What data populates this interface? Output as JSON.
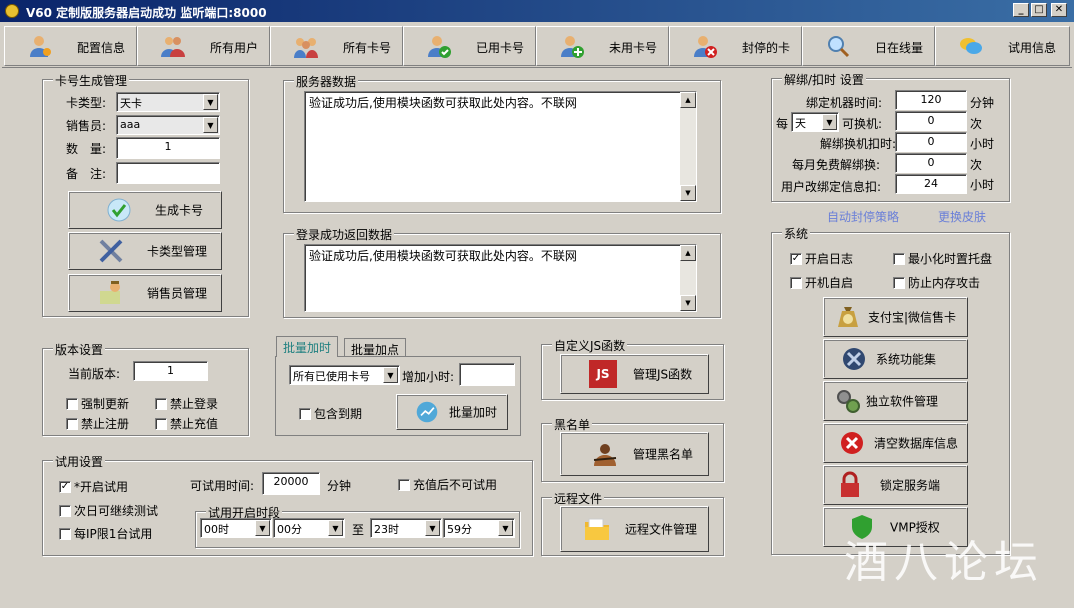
{
  "window": {
    "title": "V60 定制版服务器启动成功 监听端口:8000",
    "min": "_",
    "max": "□",
    "close": "✕"
  },
  "toolbar": [
    {
      "label": "配置信息",
      "icon": "user-settings-icon"
    },
    {
      "label": "所有用户",
      "icon": "users-icon"
    },
    {
      "label": "所有卡号",
      "icon": "people-group-icon"
    },
    {
      "label": "已用卡号",
      "icon": "user-check-icon"
    },
    {
      "label": "未用卡号",
      "icon": "user-add-icon"
    },
    {
      "label": "封停的卡",
      "icon": "user-blocked-icon"
    },
    {
      "label": "日在线量",
      "icon": "magnifier-icon"
    },
    {
      "label": "试用信息",
      "icon": "chat-bubble-icon"
    }
  ],
  "card_gen": {
    "title": "卡号生成管理",
    "type_label": "卡类型:",
    "type_value": "天卡",
    "seller_label": "销售员:",
    "seller_value": "aaa",
    "qty_label": "数　量:",
    "qty_value": "1",
    "note_label": "备　注:",
    "note_value": "",
    "gen_button": "生成卡号",
    "type_manage_button": "卡类型管理",
    "seller_manage_button": "销售员管理"
  },
  "server_data": {
    "title": "服务器数据",
    "text": "验证成功后,使用模块函数可获取此处内容。不联网"
  },
  "login_data": {
    "title": "登录成功返回数据",
    "text": "验证成功后,使用模块函数可获取此处内容。不联网"
  },
  "bind": {
    "title": "解绑/扣时 设置",
    "bind_time_label": "绑定机器时间:",
    "bind_time_value": "120",
    "bind_time_unit": "分钟",
    "per_label": "每",
    "per_value": "天",
    "change_label": "可换机:",
    "change_value": "0",
    "change_unit": "次",
    "unbind_label": "解绑换机扣时:",
    "unbind_value": "0",
    "unbind_unit": "小时",
    "free_label": "每月免费解绑换:",
    "free_value": "0",
    "free_unit": "次",
    "user_change_label": "用户改绑定信息扣:",
    "user_change_value": "24",
    "user_change_unit": "小时"
  },
  "links": {
    "auto_ban": "自动封停策略",
    "skin": "更换皮肤"
  },
  "system": {
    "title": "系统",
    "log": {
      "label": "开启日志",
      "checked": true
    },
    "tray": {
      "label": "最小化时置托盘",
      "checked": false
    },
    "autostart": {
      "label": "开机自启",
      "checked": false
    },
    "antiattack": {
      "label": "防止内存攻击",
      "checked": false
    },
    "buttons": [
      {
        "label": "支付宝|微信售卡",
        "icon": "money-bag-icon"
      },
      {
        "label": "系统功能集",
        "icon": "tools-icon"
      },
      {
        "label": "独立软件管理",
        "icon": "gears-icon"
      },
      {
        "label": "清空数据库信息",
        "icon": "clear-icon"
      },
      {
        "label": "锁定服务端",
        "icon": "lock-icon"
      },
      {
        "label": "VMP授权",
        "icon": "shield-icon"
      }
    ]
  },
  "version": {
    "title": "版本设置",
    "current_label": "当前版本:",
    "current_value": "1",
    "force_update": {
      "label": "强制更新",
      "checked": false
    },
    "no_login": {
      "label": "禁止登录",
      "checked": false
    },
    "no_register": {
      "label": "禁止注册",
      "checked": false
    },
    "no_recharge": {
      "label": "禁止充值",
      "checked": false
    }
  },
  "batch": {
    "tab_add_time": "批量加时",
    "tab_add_points": "批量加点",
    "card_scope": "所有已使用卡号",
    "add_hours_label": "增加小时:",
    "add_hours_value": "",
    "include_expired": {
      "label": "包含到期",
      "checked": false
    },
    "button": "批量加时"
  },
  "js": {
    "title": "自定义JS函数",
    "button": "管理JS函数",
    "icon_text": "JS"
  },
  "blacklist": {
    "title": "黑名单",
    "button": "管理黑名单"
  },
  "remote": {
    "title": "远程文件",
    "button": "远程文件管理"
  },
  "trial": {
    "title": "试用设置",
    "enable": {
      "label": "*开启试用",
      "checked": true
    },
    "next_day": {
      "label": "次日可继续测试",
      "checked": false
    },
    "one_per_ip": {
      "label": "每IP限1台试用",
      "checked": false
    },
    "time_label": "可试用时间:",
    "time_value": "20000",
    "time_unit": "分钟",
    "no_after_recharge": {
      "label": "充值后不可试用",
      "checked": false
    },
    "period_title": "试用开启时段",
    "from_hour": "00时",
    "from_min": "00分",
    "to_label": "至",
    "to_hour": "23时",
    "to_min": "59分"
  },
  "watermark": "酒八论坛"
}
